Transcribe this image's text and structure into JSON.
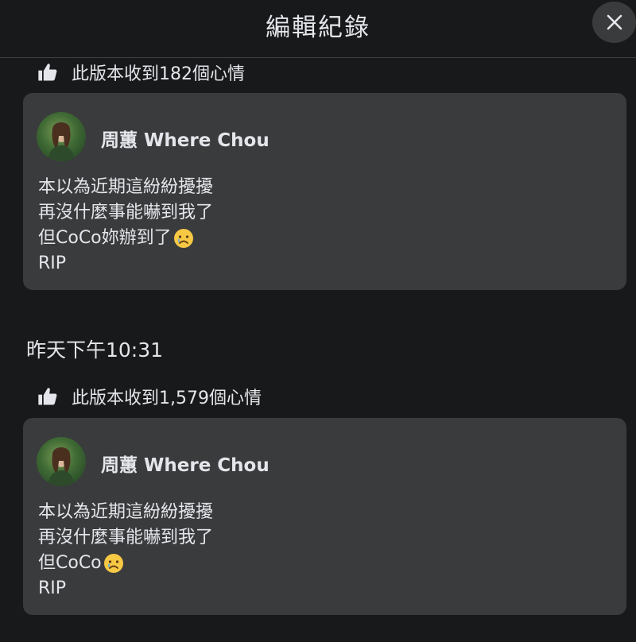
{
  "header": {
    "title": "編輯紀錄",
    "close_icon": "close-icon"
  },
  "entries": [
    {
      "reactions_text": "此版本收到182個心情",
      "reaction_icon": "like-icon",
      "post": {
        "author": "周蕙 Where Chou",
        "lines": [
          "本以為近期這紛紛擾擾",
          "再沒什麼事能嚇到我了",
          "但CoCo妳辦到了",
          "RIP"
        ],
        "emoji": "sad-face-emoji"
      }
    },
    {
      "timestamp": "昨天下午10:31",
      "reactions_text": "此版本收到1,579個心情",
      "reaction_icon": "like-icon",
      "post": {
        "author": "周蕙 Where Chou",
        "lines": [
          "本以為近期這紛紛擾擾",
          "再沒什麼事能嚇到我了",
          "但CoCo",
          "RIP"
        ],
        "emoji": "sad-face-emoji"
      }
    }
  ],
  "colors": {
    "background": "#18191a",
    "card": "#3a3b3c",
    "text": "#e4e6eb",
    "divider": "#3e4042"
  }
}
